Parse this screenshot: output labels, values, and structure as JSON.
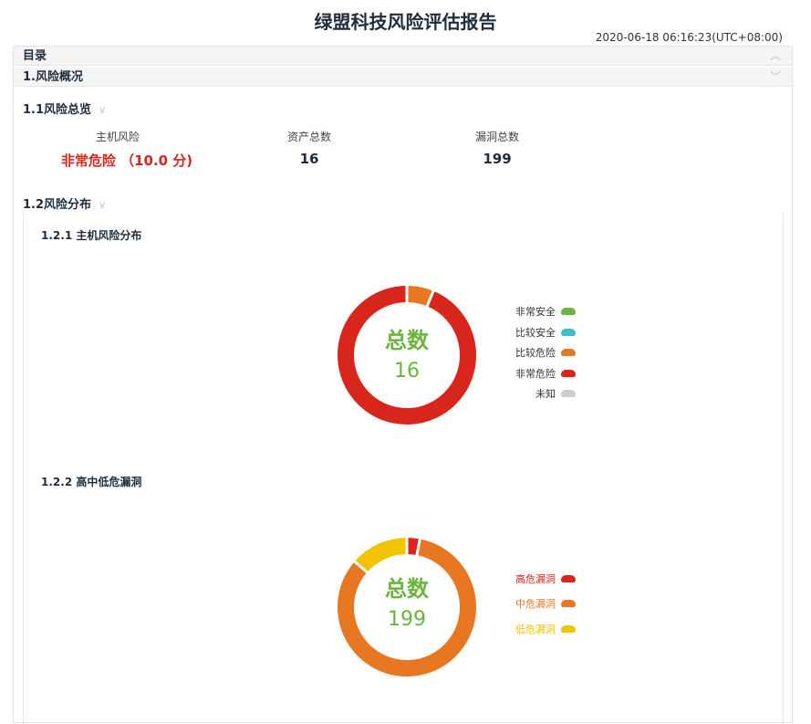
{
  "report": {
    "title": "绿盟科技风险评估报告",
    "timestamp": "2020-06-18 06:16:23(UTC+08:00)"
  },
  "toc": {
    "label": "目录",
    "icon": "chevron-up-icon"
  },
  "section1": {
    "label": "1.风险概况",
    "icon": "chevron-down-icon",
    "overview": {
      "label": "1.1风险总览",
      "host_risk_label": "主机风险",
      "host_risk_value": "非常危险 （10.0 分)",
      "asset_count_label": "资产总数",
      "asset_count_value": "16",
      "vuln_count_label": "漏洞总数",
      "vuln_count_value": "199"
    },
    "distribution": {
      "label": "1.2风险分布",
      "host_chart_title": "1.2.1 主机风险分布",
      "vuln_chart_title": "1.2.2 高中低危漏洞"
    }
  },
  "chart_data": [
    {
      "type": "pie",
      "title": "1.2.1 主机风险分布",
      "center_label": "总数",
      "total": 16,
      "categories": [
        "非常安全",
        "比较安全",
        "比较危险",
        "非常危险",
        "未知"
      ],
      "values": [
        0,
        0,
        1,
        15,
        0
      ],
      "colors": [
        "#6cb33f",
        "#3fbcc6",
        "#e87722",
        "#d9261c",
        "#cccccc"
      ],
      "legend_placement": "right"
    },
    {
      "type": "pie",
      "title": "1.2.2 高中低危漏洞",
      "center_label": "总数",
      "total": 199,
      "categories": [
        "高危漏洞",
        "中危漏洞",
        "低危漏洞"
      ],
      "values": [
        6,
        166,
        27
      ],
      "colors": [
        "#d9261c",
        "#e87722",
        "#f2c300"
      ],
      "legend_placement": "right"
    }
  ],
  "colors": {
    "accent_green": "#6cb33f",
    "danger_red": "#d9261c",
    "heading_navy": "#1f2d3d"
  }
}
